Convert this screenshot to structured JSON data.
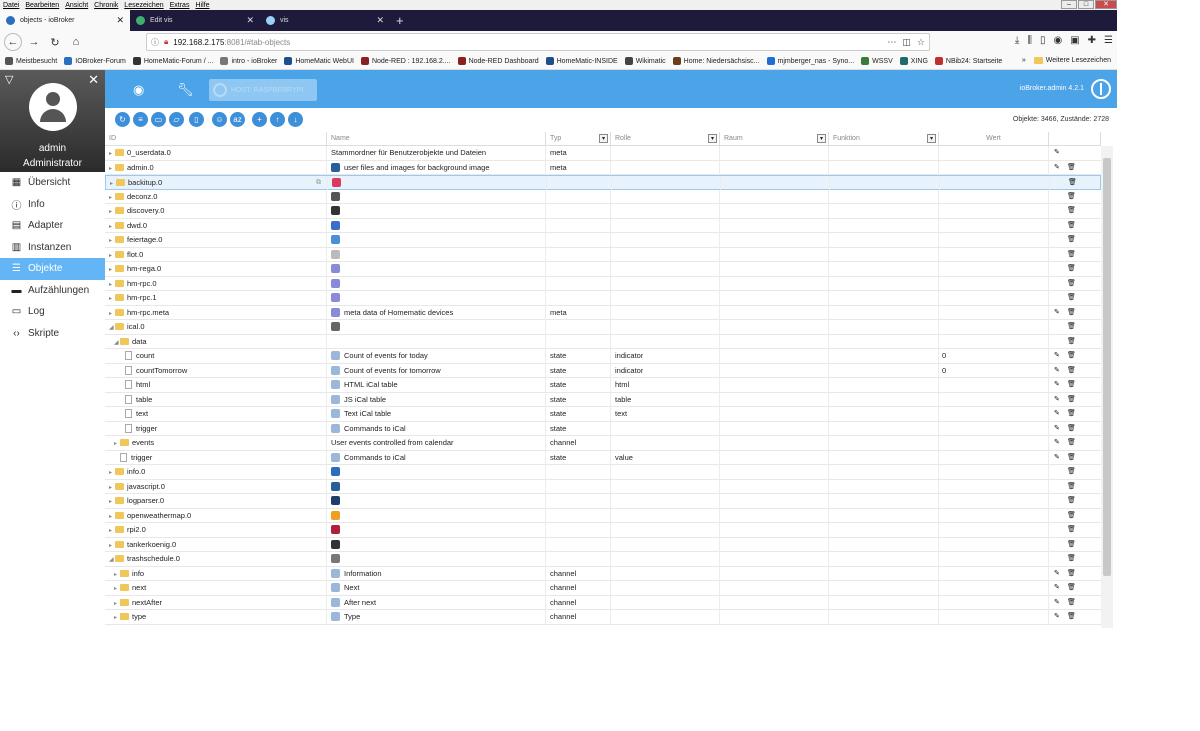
{
  "menubar": [
    "Datei",
    "Bearbeiten",
    "Ansicht",
    "Chronik",
    "Lesezeichen",
    "Extras",
    "Hilfe"
  ],
  "tabs": [
    {
      "title": "objects - ioBroker",
      "icon_color": "#2a6ebd"
    },
    {
      "title": "Edit vis",
      "icon_color": "#3fae6e"
    },
    {
      "title": "vis",
      "icon_color": "#9ad0f5"
    }
  ],
  "url": {
    "host": "192.168.2.175",
    "path": ":8081/#tab-objects"
  },
  "bookmarks": [
    {
      "label": "Meistbesucht",
      "color": "#555"
    },
    {
      "label": "IOBroker-Forum",
      "color": "#2a6ebd"
    },
    {
      "label": "HomeMatic-Forum / ...",
      "color": "#333"
    },
    {
      "label": "intro - ioBroker",
      "color": "#777"
    },
    {
      "label": "HomeMatic WebUI",
      "color": "#1f4f8a"
    },
    {
      "label": "Node-RED : 192.168.2....",
      "color": "#8b2020"
    },
    {
      "label": "Node-RED Dashboard",
      "color": "#8b2020"
    },
    {
      "label": "HomeMatic-INSIDE",
      "color": "#1f4f8a"
    },
    {
      "label": "Wikimatic",
      "color": "#444"
    },
    {
      "label": "Home: Niedersächsisc...",
      "color": "#6b3d1a"
    },
    {
      "label": "mjmberger_nas - Syno...",
      "color": "#1a6fd1"
    },
    {
      "label": "WSSV",
      "color": "#3a7a3a"
    },
    {
      "label": "XING",
      "color": "#1e6b6b"
    },
    {
      "label": "NBib24: Startseite",
      "color": "#c03030"
    }
  ],
  "bookmarks_more": "Weitere Lesezeichen",
  "user": {
    "name": "admin",
    "role": "Administrator"
  },
  "menu": [
    {
      "label": "Übersicht",
      "icon": "grid-icon",
      "glyph": "▦",
      "active": false
    },
    {
      "label": "Info",
      "icon": "info-icon",
      "glyph": "ⓘ",
      "active": false
    },
    {
      "label": "Adapter",
      "icon": "store-icon",
      "glyph": "▤",
      "active": false
    },
    {
      "label": "Instanzen",
      "icon": "instances-icon",
      "glyph": "▥",
      "active": false
    },
    {
      "label": "Objekte",
      "icon": "list-icon",
      "glyph": "☰",
      "active": true
    },
    {
      "label": "Aufzählungen",
      "icon": "enum-icon",
      "glyph": "▬",
      "active": false
    },
    {
      "label": "Log",
      "icon": "log-icon",
      "glyph": "▭",
      "active": false
    },
    {
      "label": "Skripte",
      "icon": "code-icon",
      "glyph": "‹›",
      "active": false
    }
  ],
  "host_label": "HOST: RASPBERRYPI",
  "brand": "ioBroker.admin 4.2.1",
  "stats": "Objekte: 3466, Zustände: 2728",
  "toolbar_buttons": [
    "refresh",
    "list",
    "folder",
    "folder-open",
    "view",
    "user",
    "sort-az",
    "add",
    "upload",
    "download"
  ],
  "columns": {
    "id": "ID",
    "name": "Name",
    "type": "Typ",
    "role": "Rolle",
    "room": "Raum",
    "func": "Funktion",
    "value": "Wert"
  },
  "rows": [
    {
      "level": 0,
      "kind": "folder",
      "tri": "▸",
      "id": "0_userdata.0",
      "icon": "",
      "icolor": "",
      "name": "Stammordner für Benutzerobjekte und Dateien",
      "type": "meta",
      "role": "",
      "value": "",
      "edit": true,
      "del": false
    },
    {
      "level": 0,
      "kind": "folder",
      "tri": "▸",
      "id": "admin.0",
      "icon": "admin-icon",
      "icolor": "#2a5d9e",
      "name": "user files and images for background image",
      "type": "meta",
      "role": "",
      "value": "",
      "edit": true,
      "del": true
    },
    {
      "level": 0,
      "kind": "folder",
      "tri": "▸",
      "id": "backitup.0",
      "icon": "backitup-icon",
      "icolor": "#d93b5c",
      "name": "",
      "type": "",
      "role": "",
      "value": "",
      "edit": false,
      "del": true,
      "sel": true
    },
    {
      "level": 0,
      "kind": "folder",
      "tri": "▸",
      "id": "deconz.0",
      "icon": "deconz-icon",
      "icolor": "#555",
      "name": "",
      "type": "",
      "role": "",
      "value": "",
      "edit": false,
      "del": true
    },
    {
      "level": 0,
      "kind": "folder",
      "tri": "▸",
      "id": "discovery.0",
      "icon": "discovery-icon",
      "icolor": "#333",
      "name": "",
      "type": "",
      "role": "",
      "value": "",
      "edit": false,
      "del": true
    },
    {
      "level": 0,
      "kind": "folder",
      "tri": "▸",
      "id": "dwd.0",
      "icon": "dwd-icon",
      "icolor": "#3a6fc9",
      "name": "",
      "type": "",
      "role": "",
      "value": "",
      "edit": false,
      "del": true
    },
    {
      "level": 0,
      "kind": "folder",
      "tri": "▸",
      "id": "feiertage.0",
      "icon": "feiertage-icon",
      "icolor": "#4a90d9",
      "name": "",
      "type": "",
      "role": "",
      "value": "",
      "edit": false,
      "del": true
    },
    {
      "level": 0,
      "kind": "folder",
      "tri": "▸",
      "id": "flot.0",
      "icon": "flot-icon",
      "icolor": "#bbb",
      "name": "",
      "type": "",
      "role": "",
      "value": "",
      "edit": false,
      "del": true
    },
    {
      "level": 0,
      "kind": "folder",
      "tri": "▸",
      "id": "hm-rega.0",
      "icon": "hm-rega-icon",
      "icolor": "#8a8ad8",
      "name": "",
      "type": "",
      "role": "",
      "value": "",
      "edit": false,
      "del": true
    },
    {
      "level": 0,
      "kind": "folder",
      "tri": "▸",
      "id": "hm-rpc.0",
      "icon": "hm-rpc-icon",
      "icolor": "#8a8ad8",
      "name": "",
      "type": "",
      "role": "",
      "value": "",
      "edit": false,
      "del": true
    },
    {
      "level": 0,
      "kind": "folder",
      "tri": "▸",
      "id": "hm-rpc.1",
      "icon": "hm-rpc-icon",
      "icolor": "#8a8ad8",
      "name": "",
      "type": "",
      "role": "",
      "value": "",
      "edit": false,
      "del": true
    },
    {
      "level": 0,
      "kind": "folder",
      "tri": "▸",
      "id": "hm-rpc.meta",
      "icon": "hm-rpc-icon",
      "icolor": "#8a8ad8",
      "name": "meta data of Homematic devices",
      "type": "meta",
      "role": "",
      "value": "",
      "edit": true,
      "del": true
    },
    {
      "level": 0,
      "kind": "folder",
      "tri": "◢",
      "id": "ical.0",
      "icon": "ical-icon",
      "icolor": "#666",
      "name": "",
      "type": "",
      "role": "",
      "value": "",
      "edit": false,
      "del": true
    },
    {
      "level": 1,
      "kind": "folder",
      "tri": "◢",
      "id": "data",
      "icon": "",
      "icolor": "",
      "name": "",
      "type": "",
      "role": "",
      "value": "",
      "edit": false,
      "del": true
    },
    {
      "level": 2,
      "kind": "file",
      "tri": "",
      "id": "count",
      "icon": "state-icon",
      "icolor": "#9bb8d8",
      "name": "Count of events for today",
      "type": "state",
      "role": "indicator",
      "value": "0",
      "edit": true,
      "del": true
    },
    {
      "level": 2,
      "kind": "file",
      "tri": "",
      "id": "countTomorrow",
      "icon": "state-icon",
      "icolor": "#9bb8d8",
      "name": "Count of events for tomorrow",
      "type": "state",
      "role": "indicator",
      "value": "0",
      "edit": true,
      "del": true
    },
    {
      "level": 2,
      "kind": "file",
      "tri": "",
      "id": "html",
      "icon": "state-icon",
      "icolor": "#9bb8d8",
      "name": "HTML iCal table",
      "type": "state",
      "role": "html",
      "value": "",
      "edit": true,
      "del": true
    },
    {
      "level": 2,
      "kind": "file",
      "tri": "",
      "id": "table",
      "icon": "state-icon",
      "icolor": "#9bb8d8",
      "name": "JS iCal table",
      "type": "state",
      "role": "table",
      "value": "",
      "edit": true,
      "del": true
    },
    {
      "level": 2,
      "kind": "file",
      "tri": "",
      "id": "text",
      "icon": "state-icon",
      "icolor": "#9bb8d8",
      "name": "Text iCal table",
      "type": "state",
      "role": "text",
      "value": "",
      "edit": true,
      "del": true
    },
    {
      "level": 2,
      "kind": "file",
      "tri": "",
      "id": "trigger",
      "icon": "state-icon",
      "icolor": "#9bb8d8",
      "name": "Commands to iCal",
      "type": "state",
      "role": "",
      "value": "",
      "edit": true,
      "del": true
    },
    {
      "level": 1,
      "kind": "folder",
      "tri": "▸",
      "id": "events",
      "icon": "",
      "icolor": "",
      "name": "User events controlled from calendar",
      "type": "channel",
      "role": "",
      "value": "",
      "edit": true,
      "del": true
    },
    {
      "level": 1,
      "kind": "file",
      "tri": "",
      "id": "trigger",
      "icon": "state-icon",
      "icolor": "#9bb8d8",
      "name": "Commands to iCal",
      "type": "state",
      "role": "value",
      "value": "",
      "edit": true,
      "del": true
    },
    {
      "level": 0,
      "kind": "folder",
      "tri": "▸",
      "id": "info.0",
      "icon": "info-adapter-icon",
      "icolor": "#2a6ebd",
      "name": "",
      "type": "",
      "role": "",
      "value": "",
      "edit": false,
      "del": true
    },
    {
      "level": 0,
      "kind": "folder",
      "tri": "▸",
      "id": "javascript.0",
      "icon": "javascript-icon",
      "icolor": "#2a5d9e",
      "name": "",
      "type": "",
      "role": "",
      "value": "",
      "edit": false,
      "del": true
    },
    {
      "level": 0,
      "kind": "folder",
      "tri": "▸",
      "id": "logparser.0",
      "icon": "logparser-icon",
      "icolor": "#1f3f6a",
      "name": "",
      "type": "",
      "role": "",
      "value": "",
      "edit": false,
      "del": true
    },
    {
      "level": 0,
      "kind": "folder",
      "tri": "▸",
      "id": "openweathermap.0",
      "icon": "weather-icon",
      "icolor": "#f0a020",
      "name": "",
      "type": "",
      "role": "",
      "value": "",
      "edit": false,
      "del": true
    },
    {
      "level": 0,
      "kind": "folder",
      "tri": "▸",
      "id": "rpi2.0",
      "icon": "rpi-icon",
      "icolor": "#b0203a",
      "name": "",
      "type": "",
      "role": "",
      "value": "",
      "edit": false,
      "del": true
    },
    {
      "level": 0,
      "kind": "folder",
      "tri": "▸",
      "id": "tankerkoenig.0",
      "icon": "tankerkoenig-icon",
      "icolor": "#333",
      "name": "",
      "type": "",
      "role": "",
      "value": "",
      "edit": false,
      "del": true
    },
    {
      "level": 0,
      "kind": "folder",
      "tri": "◢",
      "id": "trashschedule.0",
      "icon": "trash-icon",
      "icolor": "#777",
      "name": "",
      "type": "",
      "role": "",
      "value": "",
      "edit": false,
      "del": true
    },
    {
      "level": 1,
      "kind": "folder",
      "tri": "▸",
      "id": "info",
      "icon": "state-icon",
      "icolor": "#9bb8d8",
      "name": "Information",
      "type": "channel",
      "role": "",
      "value": "",
      "edit": true,
      "del": true
    },
    {
      "level": 1,
      "kind": "folder",
      "tri": "▸",
      "id": "next",
      "icon": "state-icon",
      "icolor": "#9bb8d8",
      "name": "Next",
      "type": "channel",
      "role": "",
      "value": "",
      "edit": true,
      "del": true
    },
    {
      "level": 1,
      "kind": "folder",
      "tri": "▸",
      "id": "nextAfter",
      "icon": "state-icon",
      "icolor": "#9bb8d8",
      "name": "After next",
      "type": "channel",
      "role": "",
      "value": "",
      "edit": true,
      "del": true
    },
    {
      "level": 1,
      "kind": "folder",
      "tri": "▸",
      "id": "type",
      "icon": "state-icon",
      "icolor": "#9bb8d8",
      "name": "Type",
      "type": "channel",
      "role": "",
      "value": "",
      "edit": true,
      "del": true
    }
  ]
}
